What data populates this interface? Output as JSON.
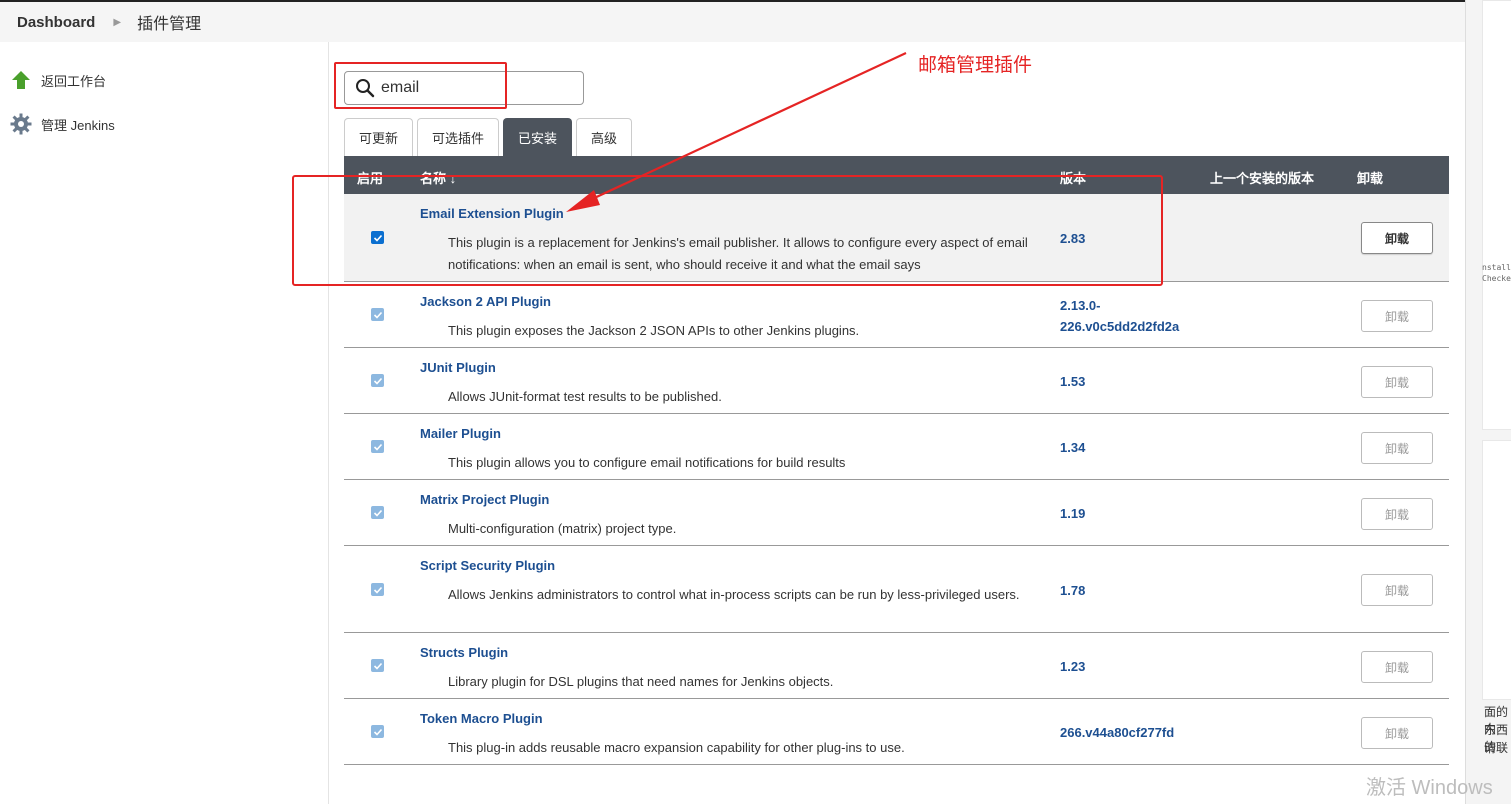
{
  "breadcrumb": {
    "home": "Dashboard",
    "current": "插件管理"
  },
  "sidebar": {
    "items": [
      {
        "label": "返回工作台",
        "icon": "arrow-up-icon"
      },
      {
        "label": "管理 Jenkins",
        "icon": "gear-icon"
      }
    ]
  },
  "search": {
    "value": "email"
  },
  "tabs": [
    {
      "label": "可更新"
    },
    {
      "label": "可选插件"
    },
    {
      "label": "已安装",
      "active": true
    },
    {
      "label": "高级"
    }
  ],
  "table": {
    "headers": {
      "enabled": "启用",
      "name": "名称 ↓",
      "version": "版本",
      "previous": "上一个安装的版本",
      "uninstall": "卸载"
    },
    "rows": [
      {
        "name": "Email Extension Plugin",
        "desc": "This plugin is a replacement for Jenkins's email publisher. It allows to configure every aspect of email notifications: when an email is sent, who should receive it and what the email says",
        "version": "2.83",
        "uninstall": "卸载",
        "enabled": true,
        "removable": true
      },
      {
        "name": "Jackson 2 API Plugin",
        "desc": "This plugin exposes the Jackson 2 JSON APIs to other Jenkins plugins.",
        "version": "2.13.0-226.v0c5dd2d2fd2a",
        "uninstall": "卸载",
        "enabled": true,
        "removable": false
      },
      {
        "name": "JUnit Plugin",
        "desc": "Allows JUnit-format test results to be published.",
        "version": "1.53",
        "uninstall": "卸载",
        "enabled": true,
        "removable": false
      },
      {
        "name": "Mailer Plugin",
        "desc": "This plugin allows you to configure email notifications for build results",
        "version": "1.34",
        "uninstall": "卸载",
        "enabled": true,
        "removable": false
      },
      {
        "name": "Matrix Project Plugin",
        "desc": "Multi-configuration (matrix) project type.",
        "version": "1.19",
        "uninstall": "卸载",
        "enabled": true,
        "removable": false
      },
      {
        "name": "Script Security Plugin",
        "desc": "Allows Jenkins administrators to control what in-process scripts can be run by less-privileged users.",
        "version": "1.78",
        "uninstall": "卸载",
        "enabled": true,
        "removable": false
      },
      {
        "name": "Structs Plugin",
        "desc": "Library plugin for DSL plugins that need names for Jenkins objects.",
        "version": "1.23",
        "uninstall": "卸载",
        "enabled": true,
        "removable": false
      },
      {
        "name": "Token Macro Plugin",
        "desc": "This plug-in adds reusable macro expansion capability for other plug-ins to use.",
        "version": "266.v44a80cf277fd",
        "uninstall": "卸载",
        "enabled": true,
        "removable": false
      }
    ]
  },
  "annotation": {
    "text": "邮箱管理插件",
    "color": "#e52424"
  },
  "watermark": "激活 Windows",
  "side_window": {
    "line1": "nstall",
    "line2": "Checke",
    "line3": "面的内",
    "line4": "东西的",
    "line5": "请联"
  },
  "colors": {
    "header_bg": "#4d545d",
    "link": "#1d4f91",
    "checkbox": "#0b6fd0"
  }
}
